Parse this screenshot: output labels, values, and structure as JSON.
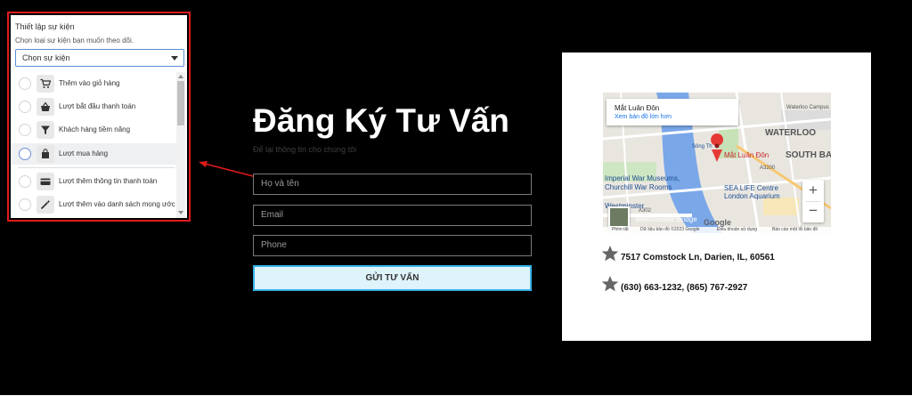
{
  "popup": {
    "title": "Thiết lập sự kiện",
    "subtitle": "Chọn loại sự kiện bạn muốn theo dõi.",
    "select_value": "Chọn sự kiện",
    "options": [
      {
        "label": "Thêm vào giỏ hàng",
        "icon": "cart-icon"
      },
      {
        "label": "Lượt bắt đầu thanh toán",
        "icon": "basket-icon"
      },
      {
        "label": "Khách hàng tiềm năng",
        "icon": "funnel-icon"
      },
      {
        "label": "Lượt mua hàng",
        "icon": "shopping-bag-icon"
      },
      {
        "label": "Lượt thêm thông tin thanh toán",
        "icon": "credit-card-icon"
      },
      {
        "label": "Lượt thêm vào danh sách mong ước",
        "icon": "magic-wand-icon"
      }
    ]
  },
  "form": {
    "title": "Đăng Ký Tư Vấn",
    "subtitle": "Để lại thông tin cho chúng tôi",
    "name_placeholder": "Họ và tên",
    "email_placeholder": "Email",
    "phone_placeholder": "Phone",
    "submit_label": "GỬI TƯ VẤN"
  },
  "map": {
    "place_name": "Mắt Luân Đôn",
    "larger_map_link": "Xem bản đồ lớn hơn",
    "labels": {
      "waterloo": "WATERLOO",
      "south_bank": "SOUTH BA",
      "marker_label": "Mắt Luân Đôn",
      "war_museum": "Imperial War Museums,",
      "churchill": "Churchill War Rooms",
      "sea_life": "SEA LIFE Centre",
      "aquarium": "London Aquarium",
      "westminster": "Westminster",
      "westminster_bridge": "Westminster Bridge",
      "a302": "A302",
      "a3200": "A3200",
      "river": "Sông Th",
      "waterloo_campus": "Waterloo Campus"
    },
    "zoom_in": "+",
    "zoom_out": "−",
    "google": "Google",
    "footer": {
      "shortcuts": "Phím tắt",
      "map_data": "Dữ liệu bản đồ ©2023 Google",
      "terms": "Điều khoản sử dụng",
      "report": "Báo cáo một lỗi bản đồ"
    }
  },
  "contact": {
    "address": "7517 Comstock Ln, Darien, IL, 60561",
    "phones": "(630) 663-1232, (865) 767-2927"
  },
  "colors": {
    "highlight_outline": "#e01b1b",
    "submit_border": "#37b2e8",
    "submit_bg": "#dff3fb",
    "map_water": "#7aa7e8",
    "marker": "#e53935"
  }
}
